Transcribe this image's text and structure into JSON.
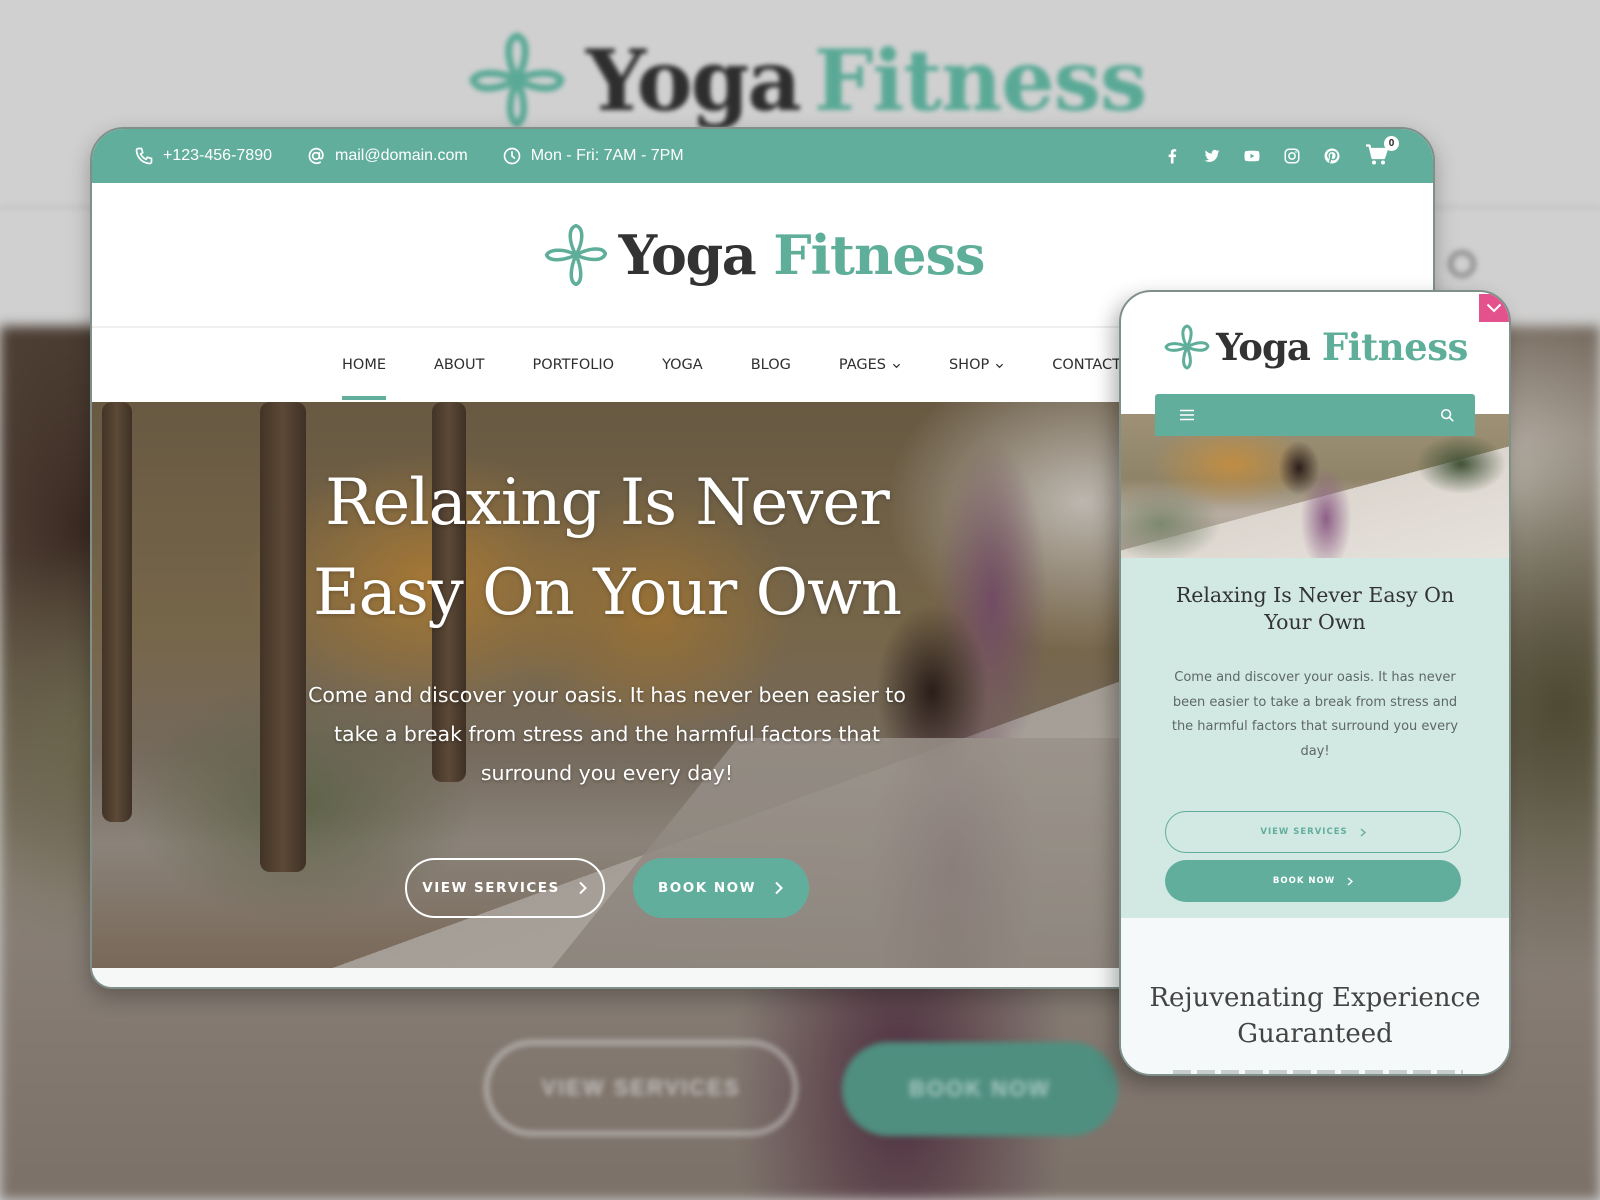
{
  "brand": {
    "name_part1": "Yoga",
    "name_part2": "Fitness",
    "logo_icon": "flower-icon",
    "colors": {
      "primary": "#62ae9c",
      "primary_light": "#d2e9e3",
      "accent_pink": "#e3528d",
      "text_dark": "#333333"
    }
  },
  "background": {
    "logo_part1": "Yoga",
    "logo_part2": "Fitness",
    "buttons": {
      "view_services": "VIEW SERVICES",
      "book_now": "BOOK NOW"
    }
  },
  "topbar": {
    "phone": {
      "icon": "phone-icon",
      "text": "+123-456-7890"
    },
    "email": {
      "icon": "at-icon",
      "text": "mail@domain.com"
    },
    "hours": {
      "icon": "clock-icon",
      "text": "Mon - Fri: 7AM - 7PM"
    },
    "social": [
      "facebook-icon",
      "twitter-icon",
      "youtube-icon",
      "instagram-icon",
      "pinterest-icon"
    ],
    "cart": {
      "icon": "cart-icon",
      "count": "0"
    }
  },
  "nav": {
    "items": [
      {
        "label": "HOME",
        "active": true,
        "dropdown": false
      },
      {
        "label": "ABOUT",
        "active": false,
        "dropdown": false
      },
      {
        "label": "PORTFOLIO",
        "active": false,
        "dropdown": false
      },
      {
        "label": "YOGA",
        "active": false,
        "dropdown": false
      },
      {
        "label": "BLOG",
        "active": false,
        "dropdown": false
      },
      {
        "label": "PAGES",
        "active": false,
        "dropdown": true
      },
      {
        "label": "SHOP",
        "active": false,
        "dropdown": true
      },
      {
        "label": "CONTACT",
        "active": false,
        "dropdown": false
      }
    ]
  },
  "hero": {
    "title_line1": "Relaxing Is Never",
    "title_line2": "Easy On Your Own",
    "text": "Come and discover your oasis. It has never been easier to take a break from stress and the harmful factors that surround you every day!",
    "buttons": {
      "view_services": "VIEW SERVICES",
      "book_now": "BOOK NOW"
    }
  },
  "mobile": {
    "toggle_icon": "chevron-down-icon",
    "menu_icon": "hamburger-icon",
    "search_icon": "search-icon",
    "hero": {
      "title": "Relaxing Is Never Easy On Your Own",
      "text": "Come and discover your oasis. It has never been easier to take a break from stress and the harmful factors that surround you every day!",
      "buttons": {
        "view_services": "VIEW SERVICES",
        "book_now": "BOOK NOW"
      }
    },
    "section_title": "Rejuvenating Experience Guaranteed"
  }
}
